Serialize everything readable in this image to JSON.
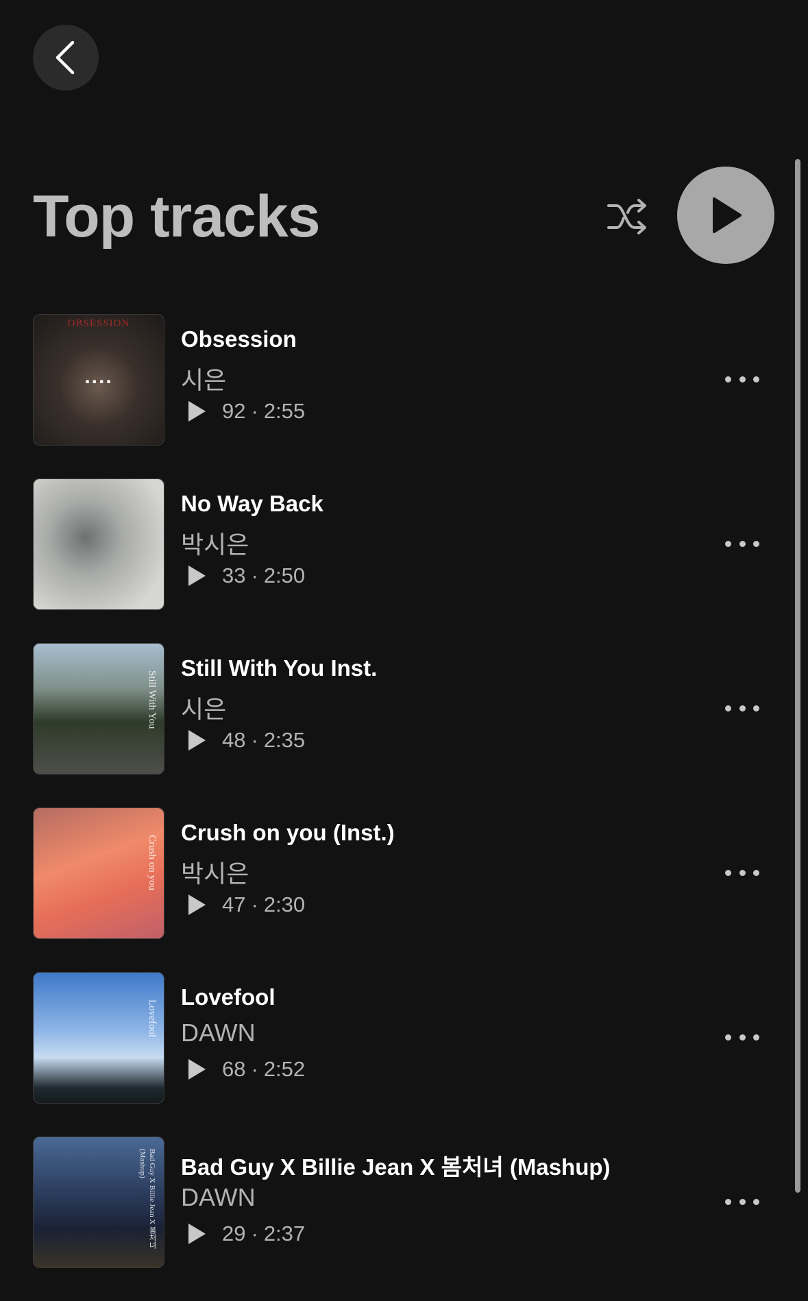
{
  "header": {
    "title": "Top tracks"
  },
  "tracks": [
    {
      "title": "Obsession",
      "artist": "시은",
      "plays": "92",
      "separator": "·",
      "duration": "2:55",
      "cover_text": "OBSESSION",
      "cover_colors": [
        "#2c2a28",
        "#4a3f38"
      ]
    },
    {
      "title": "No Way Back",
      "artist": "박시은",
      "plays": "33",
      "separator": "·",
      "duration": "2:50",
      "cover_text": "",
      "cover_colors": [
        "#c9c9c6",
        "#8e9190"
      ]
    },
    {
      "title": "Still With You Inst.",
      "artist": "시은",
      "plays": "48",
      "separator": "·",
      "duration": "2:35",
      "cover_text": "Still With You",
      "cover_colors": [
        "#9fb6c9",
        "#2f3a2b"
      ]
    },
    {
      "title": "Crush on you (Inst.)",
      "artist": "박시은",
      "plays": "47",
      "separator": "·",
      "duration": "2:30",
      "cover_text": "Crush on you",
      "cover_colors": [
        "#f08a6a",
        "#c95a4e"
      ]
    },
    {
      "title": "Lovefool",
      "artist": "DAWN",
      "plays": "68",
      "separator": "·",
      "duration": "2:52",
      "cover_text": "Lovefool",
      "cover_colors": [
        "#3f78c9",
        "#9cc0e8"
      ]
    },
    {
      "title": "Bad Guy X Billie Jean X 봄처녀 (Mashup)",
      "artist": "DAWN",
      "plays": "29",
      "separator": "·",
      "duration": "2:37",
      "cover_text": "Bad Guy X Billie Jean X 봄처녀 (Mashup)",
      "cover_colors": [
        "#2a3a5a",
        "#151c2c"
      ]
    }
  ],
  "colors": {
    "background": "#121212",
    "primary_text": "#ffffff",
    "secondary_text": "#b3b3b3",
    "play_button": "#a8a8a8",
    "back_button": "#2b2b2b"
  },
  "icons": {
    "back": "chevron-left-icon",
    "shuffle": "shuffle-icon",
    "play": "play-icon",
    "more": "more-horizontal-icon"
  }
}
